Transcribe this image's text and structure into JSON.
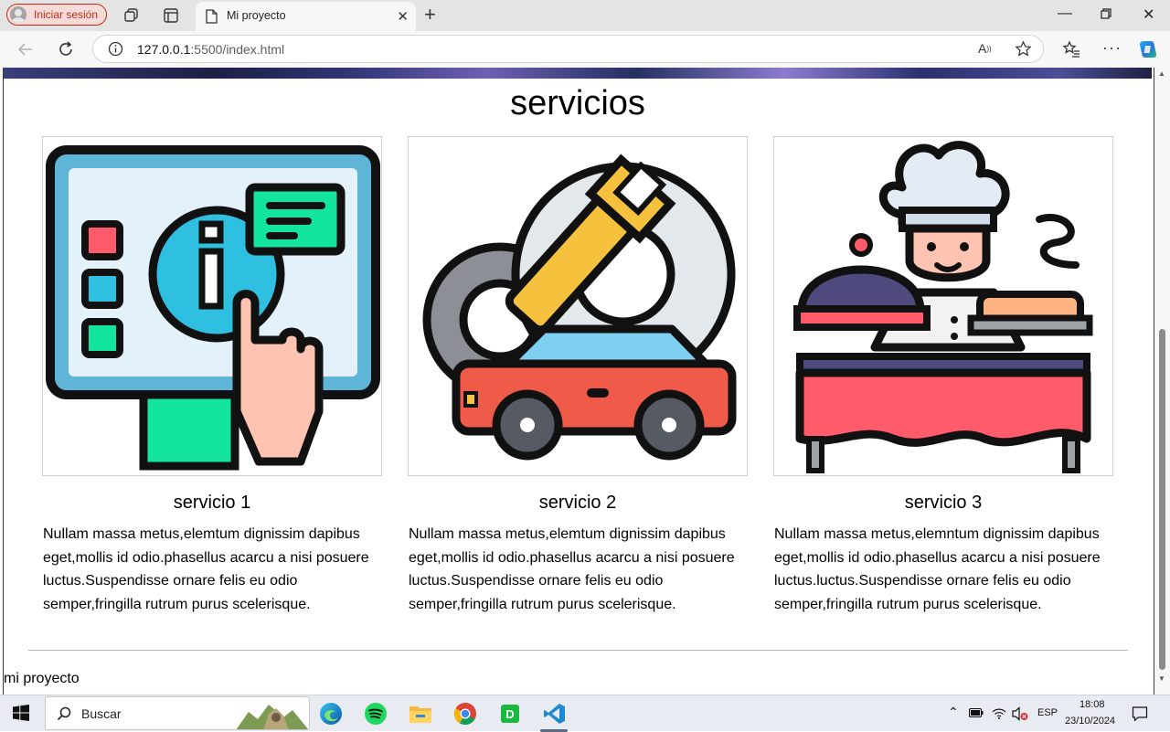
{
  "browser": {
    "signin_label": "Iniciar sesión",
    "tab_title": "Mi proyecto",
    "url_host": "127.0.0.1",
    "url_path": ":5500/index.html"
  },
  "page": {
    "section_title": "servicios",
    "cards": [
      {
        "title": "servicio 1",
        "text": "Nullam massa metus,elemtum dignissim dapibus eget,mollis id odio.phasellus acarcu a nisi posuere luctus.Suspendisse ornare felis eu odio semper,fringilla rutrum purus scelerisque.",
        "icon": "information-kiosk-icon"
      },
      {
        "title": "servicio 2",
        "text": "Nullam massa metus,elemtum dignissim dapibus eget,mollis id odio.phasellus acarcu a nisi posuere luctus.Suspendisse ornare felis eu odio semper,fringilla rutrum purus scelerisque.",
        "icon": "car-repair-icon"
      },
      {
        "title": "servicio 3",
        "text": "Nullam massa metus,elemntum dignissim dapibus eget,mollis id odio.phasellus acarcu a nisi posuere luctus.luctus.Suspendisse ornare felis eu odio semper,fringilla rutrum purus scelerisque.",
        "icon": "chef-catering-icon"
      }
    ],
    "footer_text": "mi proyecto"
  },
  "taskbar": {
    "search_label": "Buscar",
    "language": "ESP",
    "time": "18:08",
    "date": "23/10/2024"
  }
}
